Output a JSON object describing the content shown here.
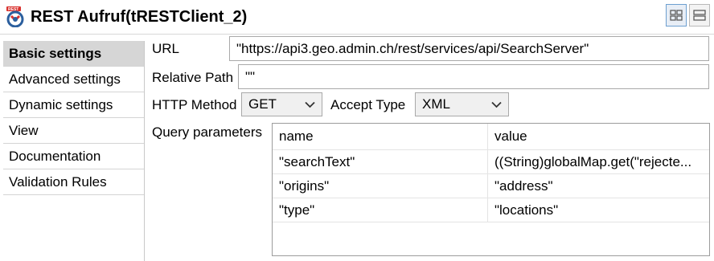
{
  "header": {
    "title": "REST Aufruf(tRESTClient_2)",
    "component_icon": "rest-component-icon",
    "view_buttons": [
      {
        "name": "grid-view-icon",
        "active": true
      },
      {
        "name": "list-view-icon",
        "active": false
      }
    ]
  },
  "sidebar": {
    "items": [
      {
        "label": "Basic settings",
        "selected": true
      },
      {
        "label": "Advanced settings",
        "selected": false
      },
      {
        "label": "Dynamic settings",
        "selected": false
      },
      {
        "label": "View",
        "selected": false
      },
      {
        "label": "Documentation",
        "selected": false
      },
      {
        "label": "Validation Rules",
        "selected": false
      }
    ]
  },
  "form": {
    "url": {
      "label": "URL",
      "value": "\"https://api3.geo.admin.ch/rest/services/api/SearchServer\""
    },
    "relative_path": {
      "label": "Relative Path",
      "value": "\"\""
    },
    "http_method": {
      "label": "HTTP Method",
      "value": "GET"
    },
    "accept_type": {
      "label": "Accept Type",
      "value": "XML"
    },
    "query_parameters": {
      "label": "Query parameters",
      "columns": [
        "name",
        "value"
      ],
      "rows": [
        [
          "\"searchText\"",
          "((String)globalMap.get(\"rejecte..."
        ],
        [
          "\"origins\"",
          "\"address\""
        ],
        [
          "\"type\"",
          "\"locations\""
        ]
      ]
    }
  },
  "colors": {
    "selected_sidebar_bg": "#d6d6d6",
    "active_view_border": "#6d9fd0",
    "icon_red": "#d9302c",
    "icon_blue": "#2b5f9e"
  }
}
